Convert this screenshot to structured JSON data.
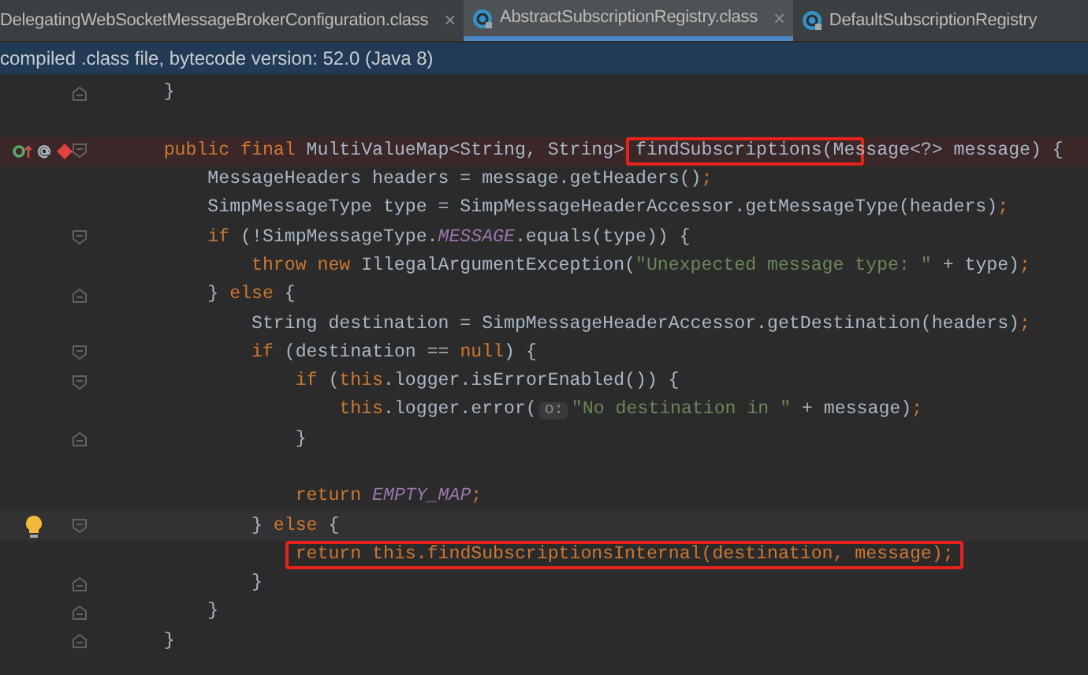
{
  "tabs": [
    {
      "label": "DelegatingWebSocketMessageBrokerConfiguration.class",
      "selected": false,
      "icon": false
    },
    {
      "label": "AbstractSubscriptionRegistry.class",
      "selected": true,
      "icon": true
    },
    {
      "label": "DefaultSubscriptionRegistry",
      "selected": false,
      "icon": true
    }
  ],
  "close_glyph": "×",
  "banner": {
    "text": "compiled .class file, bytecode version: 52.0 (Java 8)"
  },
  "code_lines": [
    {
      "kind": "code",
      "fold_end": true,
      "segments": [
        {
          "kind": "plain",
          "text": "    }"
        }
      ]
    },
    {
      "kind": "blank"
    },
    {
      "kind": "code",
      "fold_start": true,
      "breakpoint": true,
      "overrides": true,
      "annotated": true,
      "segments": [
        {
          "kind": "keyword",
          "text": "    public final "
        },
        {
          "kind": "plain",
          "text": "MultiValueMap<String, String> "
        },
        {
          "kind": "plain",
          "text": "findSubscriptions(Me",
          "boxed": true
        },
        {
          "kind": "plain",
          "text": "ssage<?> message) {"
        }
      ]
    },
    {
      "kind": "code",
      "segments": [
        {
          "kind": "plain",
          "text": "        MessageHeaders headers = message.getHeaders()"
        },
        {
          "kind": "keyword",
          "text": ";"
        }
      ]
    },
    {
      "kind": "code",
      "segments": [
        {
          "kind": "plain",
          "text": "        SimpMessageType type = SimpMessageHeaderAccessor.getMessageType(headers)"
        },
        {
          "kind": "keyword",
          "text": ";"
        }
      ]
    },
    {
      "kind": "code",
      "fold_start": true,
      "segments": [
        {
          "kind": "keyword",
          "text": "        if "
        },
        {
          "kind": "plain",
          "text": "(!SimpMessageType."
        },
        {
          "kind": "constant",
          "text": "MESSAGE"
        },
        {
          "kind": "plain",
          "text": ".equals(type)) {"
        }
      ]
    },
    {
      "kind": "code",
      "segments": [
        {
          "kind": "keyword",
          "text": "            throw new "
        },
        {
          "kind": "plain",
          "text": "IllegalArgumentException("
        },
        {
          "kind": "string",
          "text": "\"Unexpected message type: \""
        },
        {
          "kind": "plain",
          "text": " + type)"
        },
        {
          "kind": "keyword",
          "text": ";"
        }
      ]
    },
    {
      "kind": "code",
      "fold_end": true,
      "segments": [
        {
          "kind": "plain",
          "text": "        } "
        },
        {
          "kind": "keyword",
          "text": "else "
        },
        {
          "kind": "plain",
          "text": "{"
        }
      ]
    },
    {
      "kind": "code",
      "segments": [
        {
          "kind": "plain",
          "text": "            String destination = SimpMessageHeaderAccessor.getDestination(headers)"
        },
        {
          "kind": "keyword",
          "text": ";"
        }
      ]
    },
    {
      "kind": "code",
      "fold_start": true,
      "segments": [
        {
          "kind": "keyword",
          "text": "            if "
        },
        {
          "kind": "plain",
          "text": "(destination == "
        },
        {
          "kind": "keyword",
          "text": "null"
        },
        {
          "kind": "plain",
          "text": ") {"
        }
      ]
    },
    {
      "kind": "code",
      "fold_start": true,
      "segments": [
        {
          "kind": "keyword",
          "text": "                if "
        },
        {
          "kind": "plain",
          "text": "("
        },
        {
          "kind": "keyword",
          "text": "this"
        },
        {
          "kind": "plain",
          "text": ".logger.isErrorEnabled()) {"
        }
      ]
    },
    {
      "kind": "code",
      "segments": [
        {
          "kind": "keyword",
          "text": "                    this"
        },
        {
          "kind": "plain",
          "text": ".logger.error("
        },
        {
          "kind": "hint",
          "text": "o:"
        },
        {
          "kind": "string",
          "text": "\"No destination in \""
        },
        {
          "kind": "plain",
          "text": " + message)"
        },
        {
          "kind": "keyword",
          "text": ";"
        }
      ]
    },
    {
      "kind": "code",
      "fold_end": true,
      "segments": [
        {
          "kind": "plain",
          "text": "                }"
        }
      ]
    },
    {
      "kind": "blank"
    },
    {
      "kind": "code",
      "segments": [
        {
          "kind": "keyword",
          "text": "                return "
        },
        {
          "kind": "constant",
          "text": "EMPTY_MAP"
        },
        {
          "kind": "keyword",
          "text": ";"
        }
      ]
    },
    {
      "kind": "code",
      "fold_start": true,
      "current": true,
      "intention": true,
      "segments": [
        {
          "kind": "plain",
          "text": "            } "
        },
        {
          "kind": "keyword",
          "text": "else "
        },
        {
          "kind": "plain",
          "text": "{"
        }
      ]
    },
    {
      "kind": "code",
      "segments": [
        {
          "kind": "keyword",
          "boxed": true,
          "text": "                return this.findSubscriptionsInternal(destination, message);"
        }
      ]
    },
    {
      "kind": "code",
      "fold_end": true,
      "segments": [
        {
          "kind": "plain",
          "text": "            }"
        }
      ]
    },
    {
      "kind": "code",
      "fold_end": true,
      "segments": [
        {
          "kind": "plain",
          "text": "        }"
        }
      ]
    },
    {
      "kind": "code",
      "fold_end": true,
      "segments": [
        {
          "kind": "plain",
          "text": "    }"
        }
      ]
    }
  ]
}
